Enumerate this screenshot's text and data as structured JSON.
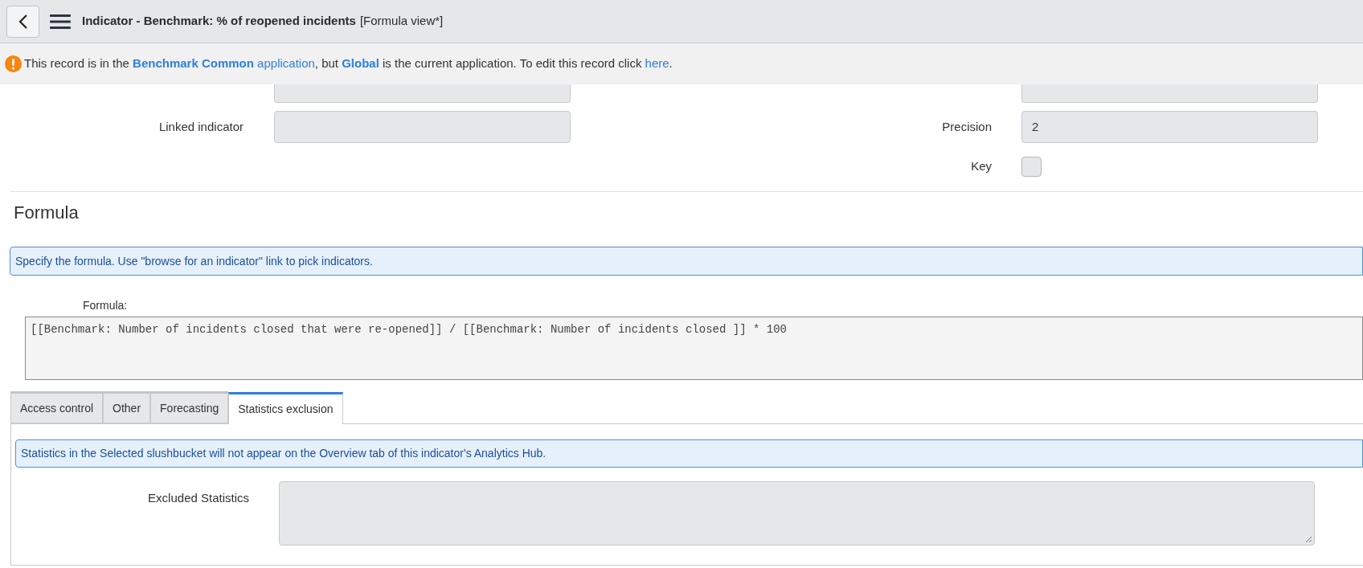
{
  "header": {
    "title": "Indicator - Benchmark: % of reopened incidents",
    "view": "[Formula view*]"
  },
  "notice": {
    "parts": [
      {
        "text": "This record is in the ",
        "kind": "plain"
      },
      {
        "text": "Benchmark Common",
        "kind": "link-bold"
      },
      {
        "text": " application",
        "kind": "link"
      },
      {
        "text": ", but ",
        "kind": "plain"
      },
      {
        "text": "Global",
        "kind": "link-bold"
      },
      {
        "text": " is the current application. To edit this record click ",
        "kind": "plain"
      },
      {
        "text": "here",
        "kind": "link"
      },
      {
        "text": ".",
        "kind": "plain"
      }
    ]
  },
  "fields_left": [
    {
      "label": "Linked indicator"
    }
  ],
  "fields_right": [
    {
      "label": "Precision",
      "value": "2",
      "kind": "text"
    },
    {
      "label": "Key",
      "kind": "checkbox",
      "checked": false
    }
  ],
  "formula_section": {
    "heading": "Formula",
    "info": "Specify the formula. Use \"browse for an indicator\" link to pick indicators.",
    "label": "Formula:",
    "value": "[[Benchmark: Number of incidents closed that were re-opened]] / [[Benchmark: Number of incidents closed ]] * 100"
  },
  "tabs": [
    {
      "label": "Access control",
      "selected": false
    },
    {
      "label": "Other",
      "selected": false
    },
    {
      "label": "Forecasting",
      "selected": false
    },
    {
      "label": "Statistics exclusion",
      "selected": true
    }
  ],
  "tab_panel": {
    "info": "Statistics in the Selected slushbucket will not appear on the Overview tab of this indicator's Analytics Hub.",
    "label": "Excluded Statistics"
  }
}
